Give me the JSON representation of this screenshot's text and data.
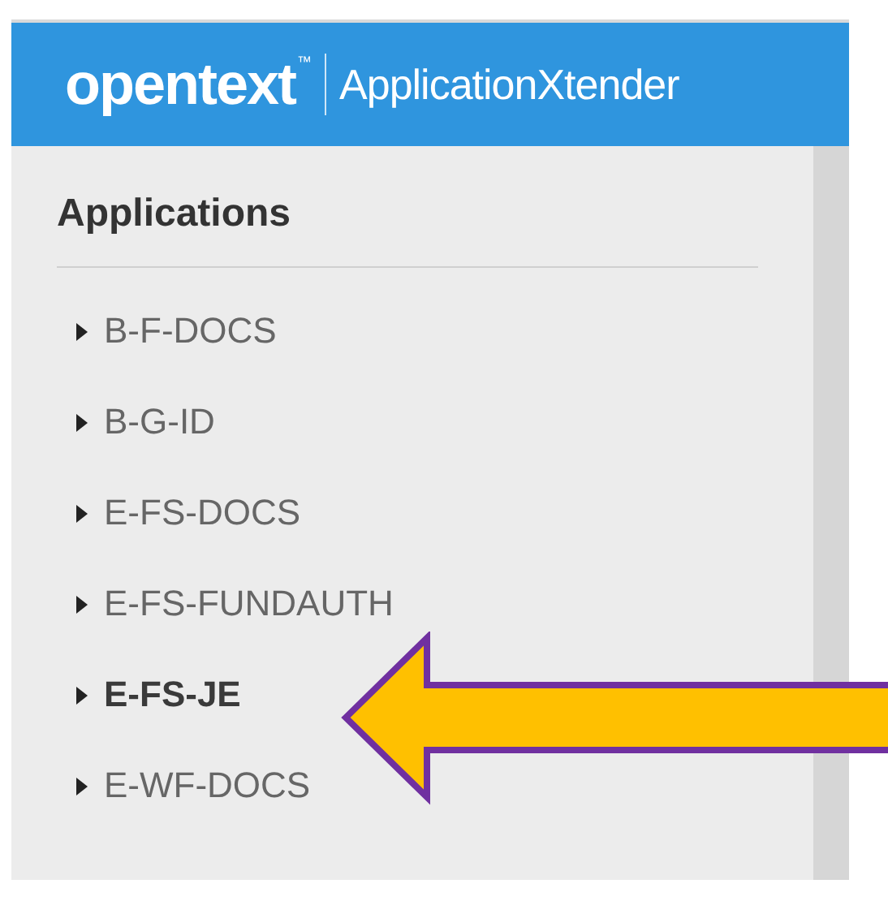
{
  "header": {
    "logo": "opentext",
    "trademark": "™",
    "product": "ApplicationXtender"
  },
  "panel": {
    "title": "Applications",
    "items": [
      {
        "label": "B-F-DOCS",
        "selected": false
      },
      {
        "label": "B-G-ID",
        "selected": false
      },
      {
        "label": "E-FS-DOCS",
        "selected": false
      },
      {
        "label": "E-FS-FUNDAUTH",
        "selected": false
      },
      {
        "label": "E-FS-JE",
        "selected": true
      },
      {
        "label": "E-WF-DOCS",
        "selected": false
      }
    ]
  }
}
